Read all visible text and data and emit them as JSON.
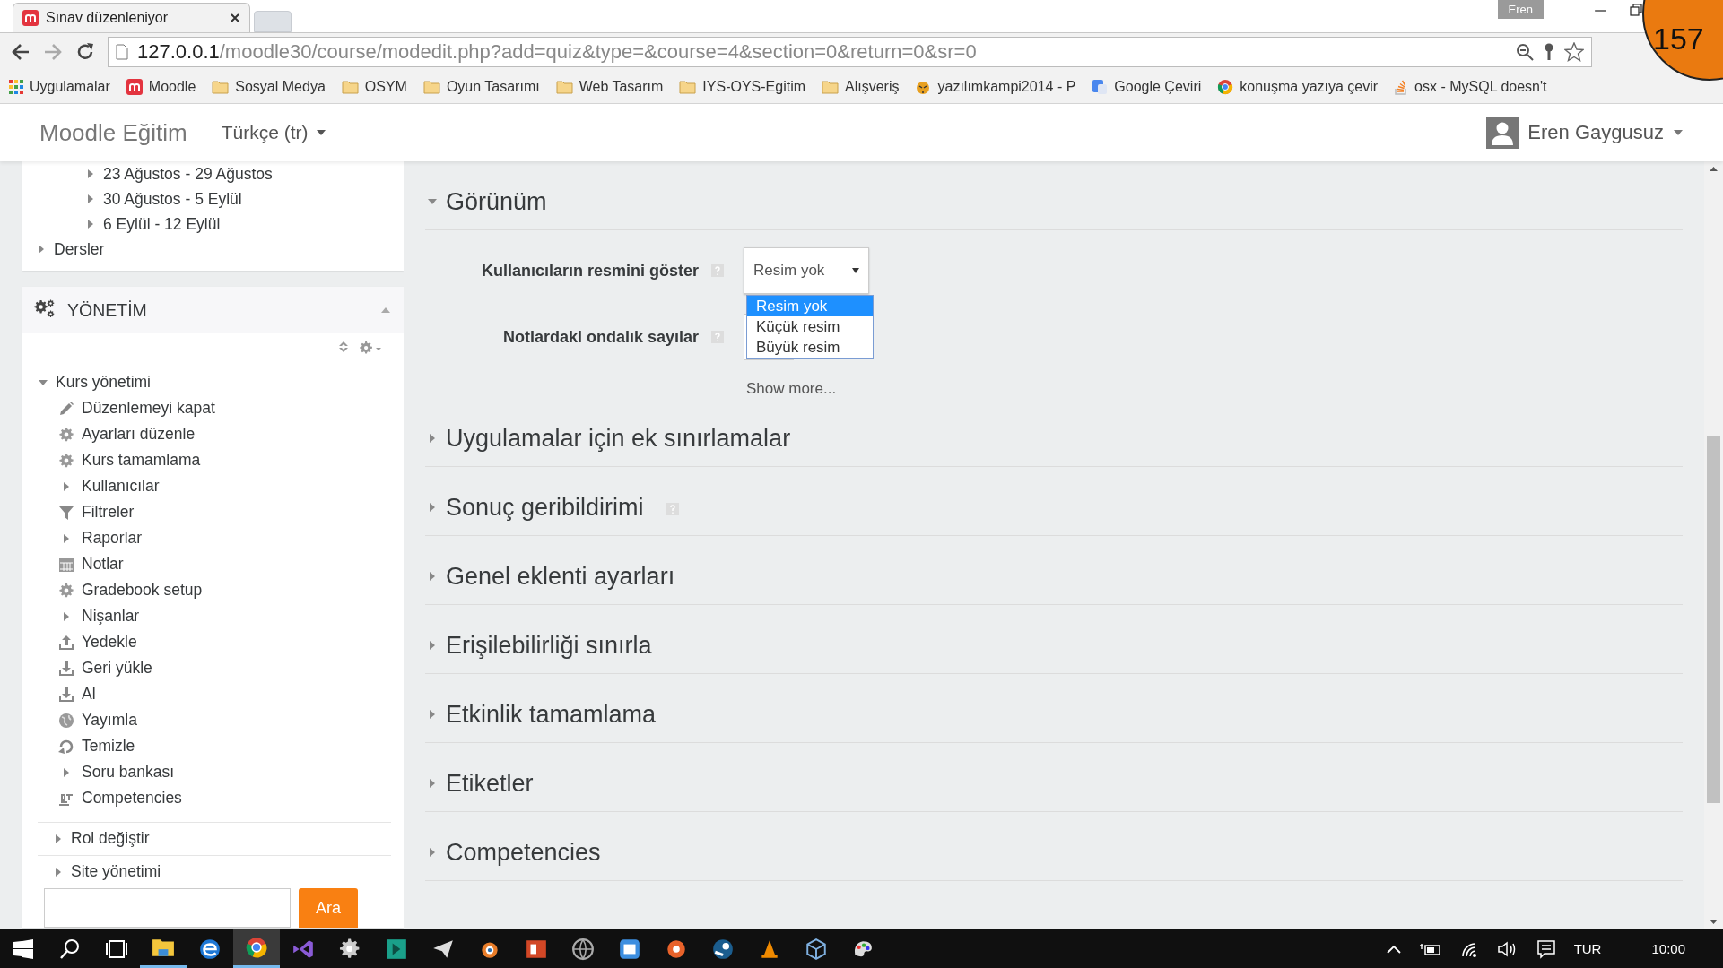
{
  "browser": {
    "tabs": [
      {
        "title": "Sınav düzenleniyor",
        "selected": true
      }
    ],
    "profile": "Eren",
    "url": {
      "host": "127.0.0.1",
      "path": "/moodle30/course/modedit.php?add=quiz&type=&course=4&section=0&return=0&sr=0"
    },
    "bookmarks": [
      {
        "label": "Uygulamalar",
        "kind": "apps"
      },
      {
        "label": "Moodle",
        "kind": "moodle"
      },
      {
        "label": "Sosyal Medya",
        "kind": "folder"
      },
      {
        "label": "OSYM",
        "kind": "folder"
      },
      {
        "label": "Oyun Tasarımı",
        "kind": "folder"
      },
      {
        "label": "Web Tasarım",
        "kind": "folder"
      },
      {
        "label": "IYS-OYS-Egitim",
        "kind": "folder"
      },
      {
        "label": "Alışveriş",
        "kind": "folder"
      },
      {
        "label": "yazılımkampi2014 - P",
        "kind": "site"
      },
      {
        "label": "Google Çeviri",
        "kind": "translate"
      },
      {
        "label": "konuşma yazıya çevir",
        "kind": "chrome"
      },
      {
        "label": "osx - MySQL doesn't",
        "kind": "stack"
      }
    ]
  },
  "corner_badge": "157",
  "navbar": {
    "brand": "Moodle Eğitim",
    "language": "Türkçe (tr)",
    "user": "Eren Gaygusuz"
  },
  "navigation": {
    "weeks": [
      {
        "label": "23 Ağustos - 29 Ağustos",
        "expanded": false
      },
      {
        "label": "30 Ağustos - 5 Eylül",
        "expanded": false
      },
      {
        "label": "6 Eylül - 12 Eylül",
        "expanded": false
      }
    ],
    "items": [
      {
        "label": "Dersler",
        "expanded": false
      }
    ]
  },
  "administration": {
    "title": "YÖNETİM",
    "collapsed": false,
    "tree": [
      {
        "label": "Kurs yönetimi",
        "expanded": true,
        "children": [
          {
            "label": "Düzenlemeyi kapat",
            "kind": "edit"
          },
          {
            "label": "Ayarları düzenle",
            "kind": "settings"
          },
          {
            "label": "Kurs tamamlama",
            "kind": "settings"
          },
          {
            "label": "Kullanıcılar",
            "kind": "branch",
            "expanded": false
          },
          {
            "label": "Filtreler",
            "kind": "filter"
          },
          {
            "label": "Raporlar",
            "kind": "branch",
            "expanded": false
          },
          {
            "label": "Notlar",
            "kind": "grades"
          },
          {
            "label": "Gradebook setup",
            "kind": "settings"
          },
          {
            "label": "Nişanlar",
            "kind": "branch",
            "expanded": false
          },
          {
            "label": "Yedekle",
            "kind": "backup"
          },
          {
            "label": "Geri yükle",
            "kind": "restore"
          },
          {
            "label": "Al",
            "kind": "restore"
          },
          {
            "label": "Yayımla",
            "kind": "publish"
          },
          {
            "label": "Temizle",
            "kind": "reset"
          },
          {
            "label": "Soru bankası",
            "kind": "branch",
            "expanded": false
          },
          {
            "label": "Competencies",
            "kind": "competencies"
          }
        ]
      },
      {
        "label": "Rol değiştir",
        "expanded": false
      },
      {
        "label": "Site yönetimi",
        "expanded": false
      }
    ],
    "search_button": "Ara"
  },
  "form": {
    "sections": [
      {
        "title": "Görünüm",
        "expanded": true,
        "help": false,
        "fields": [
          {
            "label": "Kullanıcıların resmini göster",
            "help": true,
            "value": "Resim yok",
            "open": true,
            "options": [
              {
                "label": "Resim yok",
                "selected": true
              },
              {
                "label": "Küçük resim",
                "selected": false
              },
              {
                "label": "Büyük resim",
                "selected": false
              }
            ]
          },
          {
            "label": "Notlardaki ondalık sayılar",
            "help": true
          }
        ],
        "show_more": "Show more..."
      },
      {
        "title": "Uygulamalar için ek sınırlamalar",
        "expanded": false,
        "help": false
      },
      {
        "title": "Sonuç geribildirimi",
        "expanded": false,
        "help": true
      },
      {
        "title": "Genel eklenti ayarları",
        "expanded": false,
        "help": false
      },
      {
        "title": "Erişilebilirliği sınırla",
        "expanded": false,
        "help": false
      },
      {
        "title": "Etkinlik tamamlama",
        "expanded": false,
        "help": false
      },
      {
        "title": "Etiketler",
        "expanded": false,
        "help": false
      },
      {
        "title": "Competencies",
        "expanded": false,
        "help": false
      }
    ]
  },
  "taskbar": {
    "apps": [
      {
        "kind": "files",
        "running": true,
        "active": false
      },
      {
        "kind": "edge",
        "running": false,
        "active": false
      },
      {
        "kind": "chrome",
        "running": true,
        "active": true
      },
      {
        "kind": "studio",
        "running": false,
        "active": false
      },
      {
        "kind": "gear",
        "running": false,
        "active": false
      },
      {
        "kind": "teal",
        "running": false,
        "active": false
      },
      {
        "kind": "plane",
        "running": false,
        "active": false
      },
      {
        "kind": "blender",
        "running": false,
        "active": false
      },
      {
        "kind": "slides",
        "running": false,
        "active": false
      },
      {
        "kind": "globe",
        "running": false,
        "active": false
      },
      {
        "kind": "mail",
        "running": false,
        "active": false
      },
      {
        "kind": "orange",
        "running": false,
        "active": false
      },
      {
        "kind": "steam",
        "running": false,
        "active": false
      },
      {
        "kind": "cone",
        "running": false,
        "active": false
      },
      {
        "kind": "cube",
        "running": false,
        "active": false
      },
      {
        "kind": "paint",
        "running": false,
        "active": false
      }
    ],
    "language": "TUR",
    "time": "10:00"
  }
}
